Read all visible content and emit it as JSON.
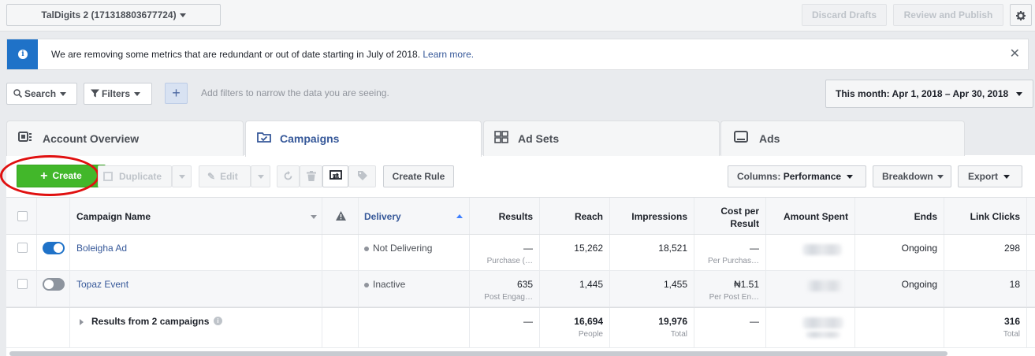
{
  "topbar": {
    "account": "TalDigits 2 (171318803677724)",
    "discard_drafts": "Discard Drafts",
    "review_publish": "Review and Publish"
  },
  "notice": {
    "message": "We are removing some metrics that are redundant or out of date starting in July of 2018.",
    "link": "Learn more."
  },
  "filters": {
    "search": "Search",
    "filters": "Filters",
    "hint": "Add filters to narrow the data you are seeing.",
    "date_range": "This month: Apr 1, 2018 – Apr 30, 2018"
  },
  "tabs": [
    {
      "label": "Account Overview"
    },
    {
      "label": "Campaigns"
    },
    {
      "label": "Ad Sets"
    },
    {
      "label": "Ads"
    }
  ],
  "toolbar": {
    "create": "Create",
    "duplicate": "Duplicate",
    "edit": "Edit",
    "create_rule": "Create Rule",
    "columns_prefix": "Columns:",
    "columns_value": "Performance",
    "breakdown": "Breakdown",
    "export": "Export"
  },
  "table": {
    "headers": {
      "name": "Campaign Name",
      "delivery": "Delivery",
      "results": "Results",
      "reach": "Reach",
      "impressions": "Impressions",
      "cost_line1": "Cost per",
      "cost_line2": "Result",
      "amount": "Amount Spent",
      "ends": "Ends",
      "clicks": "Link Clicks"
    },
    "rows": [
      {
        "name": "Boleigha Ad",
        "delivery": "Not Delivering",
        "results": "—",
        "results_sub": "Purchase (…",
        "reach": "15,262",
        "impressions": "18,521",
        "cost": "—",
        "cost_sub": "Per Purchas…",
        "ends": "Ongoing",
        "clicks": "298",
        "active": true
      },
      {
        "name": "Topaz Event",
        "delivery": "Inactive",
        "results": "635",
        "results_sub": "Post Engag…",
        "reach": "1,445",
        "impressions": "1,455",
        "cost": "₦1.51",
        "cost_sub": "Per Post En…",
        "ends": "Ongoing",
        "clicks": "18",
        "active": false
      }
    ],
    "summary": {
      "label": "Results from 2 campaigns",
      "results": "—",
      "reach": "16,694",
      "reach_sub": "People",
      "impressions": "19,976",
      "impressions_sub": "Total",
      "cost": "—",
      "clicks": "316",
      "clicks_sub": "Total"
    }
  },
  "colors": {
    "accent": "#365899",
    "create_green": "#42b72a",
    "info_blue": "#1f72c8",
    "annotation_red": "#e01010"
  }
}
